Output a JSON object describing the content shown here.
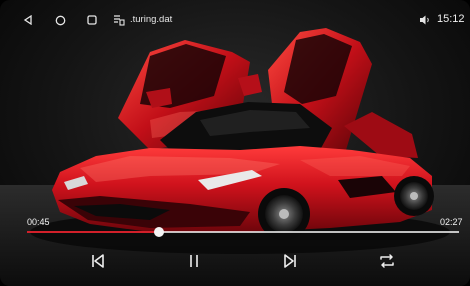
{
  "status_bar": {
    "file_name": ".turing.dat",
    "clock": "15:12",
    "icons": [
      "back-icon",
      "home-icon",
      "recent-apps-icon",
      "file-icon",
      "volume-icon"
    ]
  },
  "player": {
    "elapsed": "00:45",
    "total": "02:27",
    "progress_fraction": 0.306
  },
  "controls": [
    "previous-icon",
    "pause-icon",
    "next-icon",
    "repeat-icon"
  ],
  "colors": {
    "accent": "#d2202a",
    "car_red": "#c8141e",
    "text": "#f0f0f0"
  }
}
